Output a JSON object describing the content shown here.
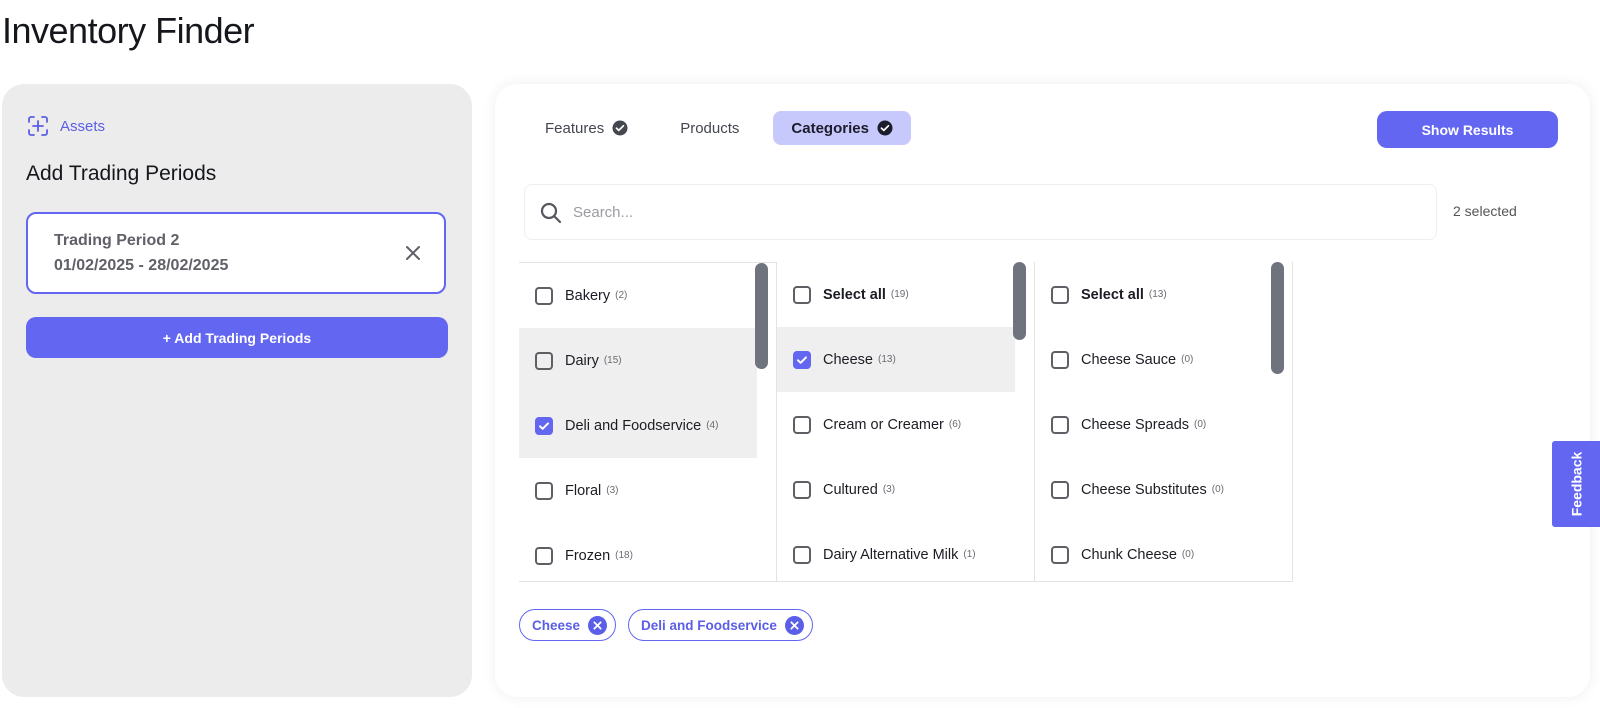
{
  "page": {
    "title": "Inventory Finder"
  },
  "sidebar": {
    "assets_label": "Assets",
    "heading": "Add Trading Periods",
    "period": {
      "name": "Trading Period 2",
      "dates": "01/02/2025 - 28/02/2025"
    },
    "add_button_label": "+ Add Trading Periods"
  },
  "tabs": [
    {
      "label": "Features",
      "completed": true,
      "active": false
    },
    {
      "label": "Products",
      "completed": false,
      "active": false
    },
    {
      "label": "Categories",
      "completed": true,
      "active": true
    }
  ],
  "show_results_label": "Show Results",
  "search": {
    "placeholder": "Search...",
    "value": ""
  },
  "selected_count": "2 selected",
  "columns": [
    {
      "items": [
        {
          "label": "Bakery",
          "count": "(2)",
          "checked": false,
          "highlight": false
        },
        {
          "label": "Dairy",
          "count": "(15)",
          "checked": false,
          "highlight": true
        },
        {
          "label": "Deli and Foodservice",
          "count": "(4)",
          "checked": true,
          "highlight": true
        },
        {
          "label": "Floral",
          "count": "(3)",
          "checked": false,
          "highlight": false
        },
        {
          "label": "Frozen",
          "count": "(18)",
          "checked": false,
          "highlight": false
        }
      ]
    },
    {
      "items": [
        {
          "label": "Select all",
          "count": "(19)",
          "checked": false,
          "highlight": false,
          "bold": true
        },
        {
          "label": "Cheese",
          "count": "(13)",
          "checked": true,
          "highlight": true
        },
        {
          "label": "Cream or Creamer",
          "count": "(6)",
          "checked": false,
          "highlight": false
        },
        {
          "label": "Cultured",
          "count": "(3)",
          "checked": false,
          "highlight": false
        },
        {
          "label": "Dairy Alternative Milk",
          "count": "(1)",
          "checked": false,
          "highlight": false
        }
      ]
    },
    {
      "items": [
        {
          "label": "Select all",
          "count": "(13)",
          "checked": false,
          "highlight": false,
          "bold": true
        },
        {
          "label": "Cheese Sauce",
          "count": "(0)",
          "checked": false,
          "highlight": false
        },
        {
          "label": "Cheese Spreads",
          "count": "(0)",
          "checked": false,
          "highlight": false
        },
        {
          "label": "Cheese Substitutes",
          "count": "(0)",
          "checked": false,
          "highlight": false
        },
        {
          "label": "Chunk Cheese",
          "count": "(0)",
          "checked": false,
          "highlight": false
        }
      ]
    }
  ],
  "chips": [
    {
      "label": "Cheese"
    },
    {
      "label": "Deli and Foodservice"
    }
  ],
  "feedback_label": "Feedback",
  "colors": {
    "accent": "#6366f1",
    "active_tab_bg": "#c7c8fb",
    "panel_bg": "#ececec"
  }
}
